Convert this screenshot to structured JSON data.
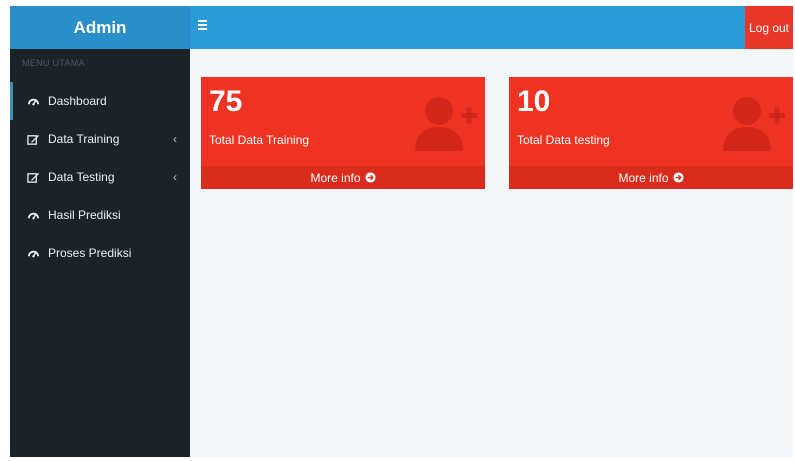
{
  "sidebar": {
    "brand": "Admin",
    "menu_header": "MENU UTAMA",
    "items": [
      {
        "label": "Dashboard",
        "icon": "dashboard-icon"
      },
      {
        "label": "Data Training",
        "icon": "edit-icon",
        "chevron": "‹"
      },
      {
        "label": "Data Testing",
        "icon": "edit-icon",
        "chevron": "‹"
      },
      {
        "label": "Hasil Prediksi",
        "icon": "dashboard-icon"
      },
      {
        "label": "Proses Prediksi",
        "icon": "dashboard-icon"
      }
    ]
  },
  "topbar": {
    "logout_label": "Log out"
  },
  "boxes": [
    {
      "value": "75",
      "label": "Total Data Training",
      "footer": "More info",
      "color": "#ee3322"
    },
    {
      "value": "10",
      "label": "Total Data testing",
      "footer": "More info",
      "color": "#ee3322"
    }
  ],
  "colors": {
    "sidebar_bg": "#1c2328",
    "brand_bg": "#2a8fc9",
    "topbar_bg": "#2a9bd9",
    "logout_bg": "#e83628",
    "box_bg": "#ee3322",
    "box_footer_bg": "#da2c1c"
  }
}
